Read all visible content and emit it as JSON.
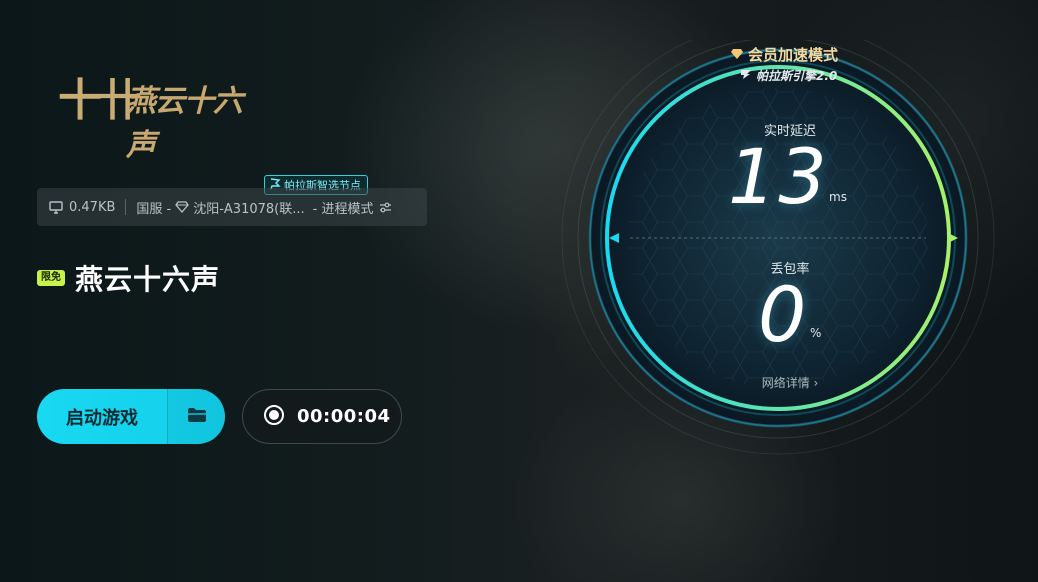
{
  "logo": {
    "mark": "十卄",
    "text": "燕云十六声"
  },
  "infobar": {
    "traffic": "0.47KB",
    "region": "国服 -",
    "node": "沈阳-A31078(联...",
    "mode": "- 进程模式",
    "node_badge": "帕拉斯智选节点"
  },
  "game": {
    "free_tag": "限免",
    "title": "燕云十六声"
  },
  "actions": {
    "launch_label": "启动游戏",
    "timer": "00:00:04"
  },
  "gauge": {
    "vip_mode": "会员加速模式",
    "engine": "帕拉斯引擎2.0",
    "latency_label": "实时延迟",
    "latency_value": "13",
    "latency_unit": "ms",
    "loss_label": "丢包率",
    "loss_value": "0",
    "loss_unit": "%",
    "details_link": "网络详情 ›"
  },
  "colors": {
    "accent": "#19d8f2",
    "gauge_green": "#a6f26a",
    "gold": "#f6d9a0",
    "free_tag": "#c7f24a"
  },
  "icons": [
    "monitor-icon",
    "diamond-icon",
    "settings-sliders-icon",
    "flag-icon",
    "folder-icon",
    "record-icon",
    "gem-icon",
    "engine-flag-icon",
    "chevron-right-icon"
  ]
}
